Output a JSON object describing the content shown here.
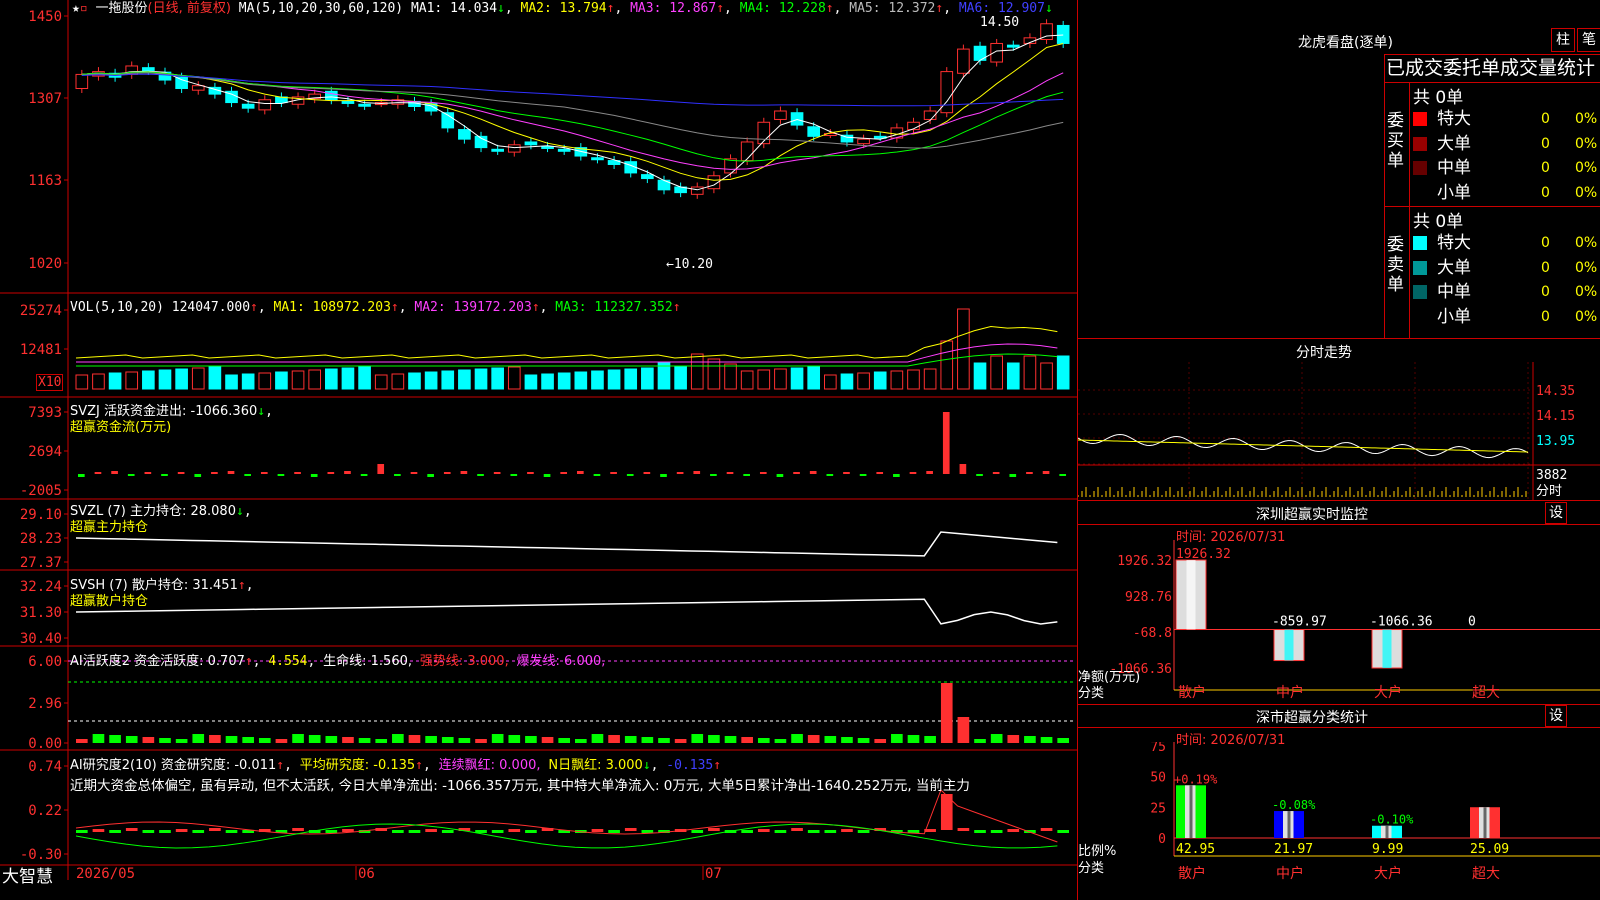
{
  "stock": {
    "name": "一拖股份",
    "mode": "(日线, 前复权)"
  },
  "kline": {
    "ma_title": "MA(5,10,20,30,60,120)",
    "ma1": "MA1: 14.034",
    "ma1_arrow": "↓",
    "ma2": "MA2: 13.794",
    "ma2_arrow": "↑",
    "ma3": "MA3: 12.867",
    "ma3_arrow": "↑",
    "ma4": "MA4: 12.228",
    "ma4_arrow": "↑",
    "ma5": "MA5: 12.372",
    "ma5_arrow": "↑",
    "ma6": "MA6: 12.907",
    "ma6_arrow": "↓",
    "yticks": [
      "1450",
      "1307",
      "1163",
      "1020"
    ],
    "high_label": "14.50",
    "low_label": "10.20",
    "colors": {
      "up": "#ff3030",
      "down": "#00ffff",
      "ma1": "#ffffff",
      "ma2": "#ffff00",
      "ma3": "#ff40ff",
      "ma4": "#00ff00",
      "ma5": "#888888",
      "ma6": "#3030ff"
    }
  },
  "vol": {
    "title": "VOL(5,10,20)",
    "value": "124047.000",
    "arrow": "↑",
    "ma1": "MA1: 108972.203",
    "ma2": "MA2: 139172.203",
    "ma3": "MA3: 112327.352",
    "yticks": [
      "25274",
      "12481"
    ],
    "unit": "X10"
  },
  "svzj": {
    "title": "SVZJ  活跃资金进出: -1066.360",
    "arrow": "↓",
    "sub": "超赢资金流(万元)",
    "yticks": [
      "7393",
      "2694",
      "-2005"
    ]
  },
  "svzl": {
    "title": "SVZL (7) 主力持仓: 28.080",
    "arrow": "↓",
    "sub": "超赢主力持仓",
    "yticks": [
      "29.10",
      "28.23",
      "27.37"
    ]
  },
  "svsh": {
    "title": "SVSH (7) 散户持仓: 31.451",
    "arrow": "↑",
    "sub": "超赢散户持仓",
    "yticks": [
      "32.24",
      "31.30",
      "30.40"
    ]
  },
  "ai1": {
    "title": "AI活跃度2 资金活跃度: 0.707",
    "arrow": "↑",
    "v2": "4.554",
    "life": "生命线: 1.560,",
    "strong": "强势线: 3.000,",
    "burst": "爆发线: 6.000,",
    "yticks": [
      "6.00",
      "2.96",
      "0.00"
    ]
  },
  "ai2": {
    "title": "AI研究度2(10) 资金研究度: -0.011",
    "arrow": "↑",
    "avg": "平均研究度: -0.135",
    "cont": "连续飘红: 0.000,",
    "nday": "N日飘红: 3.000",
    "last": "-0.135",
    "comment": "近期大资金总体偏空, 虽有异动, 但不太活跃, 今日大单净流出: -1066.357万元, 其中特大单净流入: 0万元, 大单5日累计净出-1640.252万元, 当前主力",
    "yticks": [
      "0.74",
      "0.22",
      "-0.30"
    ]
  },
  "xaxis": {
    "labels": [
      "2026/05",
      "06",
      "07"
    ],
    "brand": "大智慧"
  },
  "lhb": {
    "title": "龙虎看盘(逐单)",
    "btn1": "柱",
    "btn2": "笔",
    "header": "已成交委托单成交量统计",
    "buy_side": "委买单",
    "sell_side": "委卖单",
    "buy_total": "共 0单",
    "sell_total": "共 0单",
    "buy_rows": [
      {
        "label": "特大",
        "value": "0",
        "pct": "0%",
        "color": "#ff0000"
      },
      {
        "label": "大单",
        "value": "0",
        "pct": "0%",
        "color": "#990000"
      },
      {
        "label": "中单",
        "value": "0",
        "pct": "0%",
        "color": "#660000"
      },
      {
        "label": "小单",
        "value": "0",
        "pct": "0%",
        "color": ""
      }
    ],
    "sell_rows": [
      {
        "label": "特大",
        "value": "0",
        "pct": "0%",
        "color": "#00ffff"
      },
      {
        "label": "大单",
        "value": "0",
        "pct": "0%",
        "color": "#009999"
      },
      {
        "label": "中单",
        "value": "0",
        "pct": "0%",
        "color": "#006666"
      },
      {
        "label": "小单",
        "value": "0",
        "pct": "0%",
        "color": ""
      }
    ]
  },
  "intraday": {
    "title": "分时走势",
    "yticks": [
      "14.35",
      "14.15",
      "13.95"
    ],
    "vol": "3882",
    "unit": "分时"
  },
  "monitor": {
    "title": "深圳超赢实时监控",
    "btn": "设",
    "time": "时间: 2026/07/31",
    "yticks": [
      "1926.32",
      "928.76",
      "-68.8",
      "-1066.36"
    ],
    "ylabel": "净额(万元)",
    "xlabel": "分类",
    "categories": [
      "散户",
      "中户",
      "大户",
      "超大"
    ],
    "values_text": [
      "1926.32",
      "-859.97",
      "-1066.36",
      "0"
    ],
    "values": [
      1926.32,
      -859.97,
      -1066.36,
      0
    ]
  },
  "classify": {
    "title": "深市超赢分类统计",
    "btn": "设",
    "time": "时间: 2026/07/31",
    "yticks": [
      "75",
      "50",
      "25",
      "0"
    ],
    "ylabel": "比例%",
    "xlabel": "分类",
    "categories": [
      "散户",
      "中户",
      "大户",
      "超大"
    ],
    "pct_top": [
      "+0.19%",
      "-0.08%",
      "-0.10%",
      ""
    ],
    "pct_bottom": [
      "42.95",
      "21.97",
      "9.99",
      "25.09"
    ],
    "values": [
      42.95,
      21.97,
      9.99,
      25.09
    ]
  }
}
